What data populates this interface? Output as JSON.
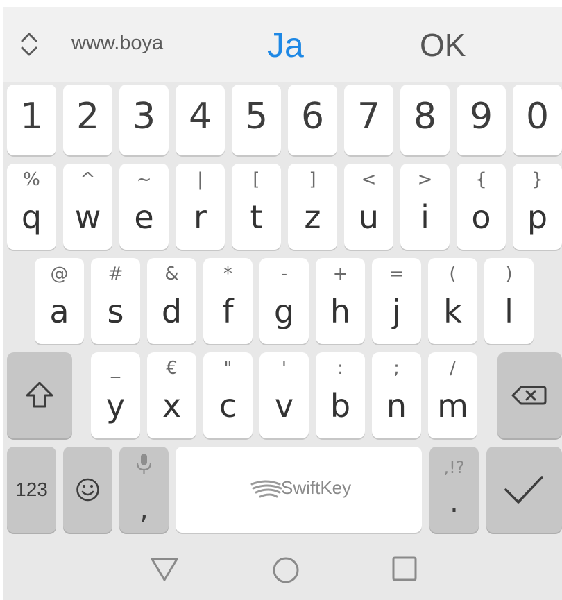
{
  "suggestions": {
    "left": "www.boya",
    "middle": "Ja",
    "right": "OK"
  },
  "number_row": [
    "1",
    "2",
    "3",
    "4",
    "5",
    "6",
    "7",
    "8",
    "9",
    "0"
  ],
  "row1": [
    {
      "primary": "q",
      "secondary": "%"
    },
    {
      "primary": "w",
      "secondary": "^"
    },
    {
      "primary": "e",
      "secondary": "~"
    },
    {
      "primary": "r",
      "secondary": "|"
    },
    {
      "primary": "t",
      "secondary": "["
    },
    {
      "primary": "z",
      "secondary": "]"
    },
    {
      "primary": "u",
      "secondary": "<"
    },
    {
      "primary": "i",
      "secondary": ">"
    },
    {
      "primary": "o",
      "secondary": "{"
    },
    {
      "primary": "p",
      "secondary": "}"
    }
  ],
  "row2": [
    {
      "primary": "a",
      "secondary": "@"
    },
    {
      "primary": "s",
      "secondary": "#"
    },
    {
      "primary": "d",
      "secondary": "&"
    },
    {
      "primary": "f",
      "secondary": "*"
    },
    {
      "primary": "g",
      "secondary": "-"
    },
    {
      "primary": "h",
      "secondary": "+"
    },
    {
      "primary": "j",
      "secondary": "="
    },
    {
      "primary": "k",
      "secondary": "("
    },
    {
      "primary": "l",
      "secondary": ")"
    }
  ],
  "row3": [
    {
      "primary": "y",
      "secondary": "_"
    },
    {
      "primary": "x",
      "secondary": "€"
    },
    {
      "primary": "c",
      "secondary": "\""
    },
    {
      "primary": "v",
      "secondary": "'"
    },
    {
      "primary": "b",
      "secondary": ":"
    },
    {
      "primary": "n",
      "secondary": ";"
    },
    {
      "primary": "m",
      "secondary": "/"
    }
  ],
  "bottom": {
    "numbers_label": "123",
    "comma": ",",
    "space_brand": "SwiftKey",
    "punct_secondary": ",!?",
    "period": "."
  },
  "icons": {
    "expand": "expand-collapse-icon",
    "shift": "shift-icon",
    "backspace": "backspace-icon",
    "emoji": "emoji-icon",
    "mic": "microphone-icon",
    "enter": "checkmark-icon",
    "brand": "swiftkey-logo-icon",
    "nav_back": "nav-back-icon",
    "nav_home": "nav-home-icon",
    "nav_recents": "nav-recents-icon"
  },
  "colors": {
    "accent": "#1e88e5",
    "key": "#ffffff",
    "function_key": "#c6c6c6",
    "background": "#e8e8e8"
  }
}
